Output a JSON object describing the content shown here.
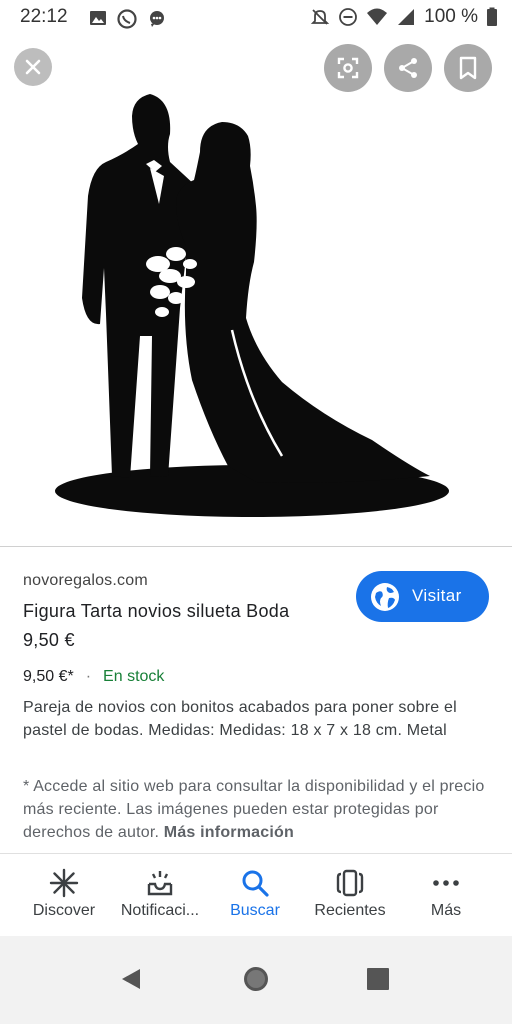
{
  "status_bar": {
    "time": "22:12",
    "battery": "100 %"
  },
  "image": {
    "alt_icon_name": "bride-groom-silhouette-cake-topper"
  },
  "top_controls": {
    "close_icon": "close-icon",
    "lens_icon": "lens-icon",
    "share_icon": "share-icon",
    "bookmark_icon": "bookmark-icon"
  },
  "result": {
    "domain": "novoregalos.com",
    "title": "Figura Tarta novios silueta Boda",
    "price": "9,50 €",
    "visit_label": "Visitar",
    "meta_price": "9,50 €*",
    "meta_dot": "·",
    "stock": "En stock",
    "description": "Pareja de novios con bonitos acabados para poner sobre el pastel de bodas. Medidas: Medidas: 18 x 7 x 18 cm. Metal",
    "disclaimer": "* Accede al sitio web para consultar la disponibilidad y el precio más reciente. Las imágenes pueden estar protegidas por derechos de autor.",
    "more_info": "Más información"
  },
  "bottom_nav": {
    "items": [
      {
        "label": "Discover",
        "icon": "discover-icon"
      },
      {
        "label": "Notificaci...",
        "icon": "notifications-icon"
      },
      {
        "label": "Buscar",
        "icon": "search-icon"
      },
      {
        "label": "Recientes",
        "icon": "recents-icon"
      },
      {
        "label": "Más",
        "icon": "more-icon"
      }
    ],
    "active_index": 2
  },
  "colors": {
    "accent": "#1a73e8",
    "stock_green": "#188038"
  }
}
